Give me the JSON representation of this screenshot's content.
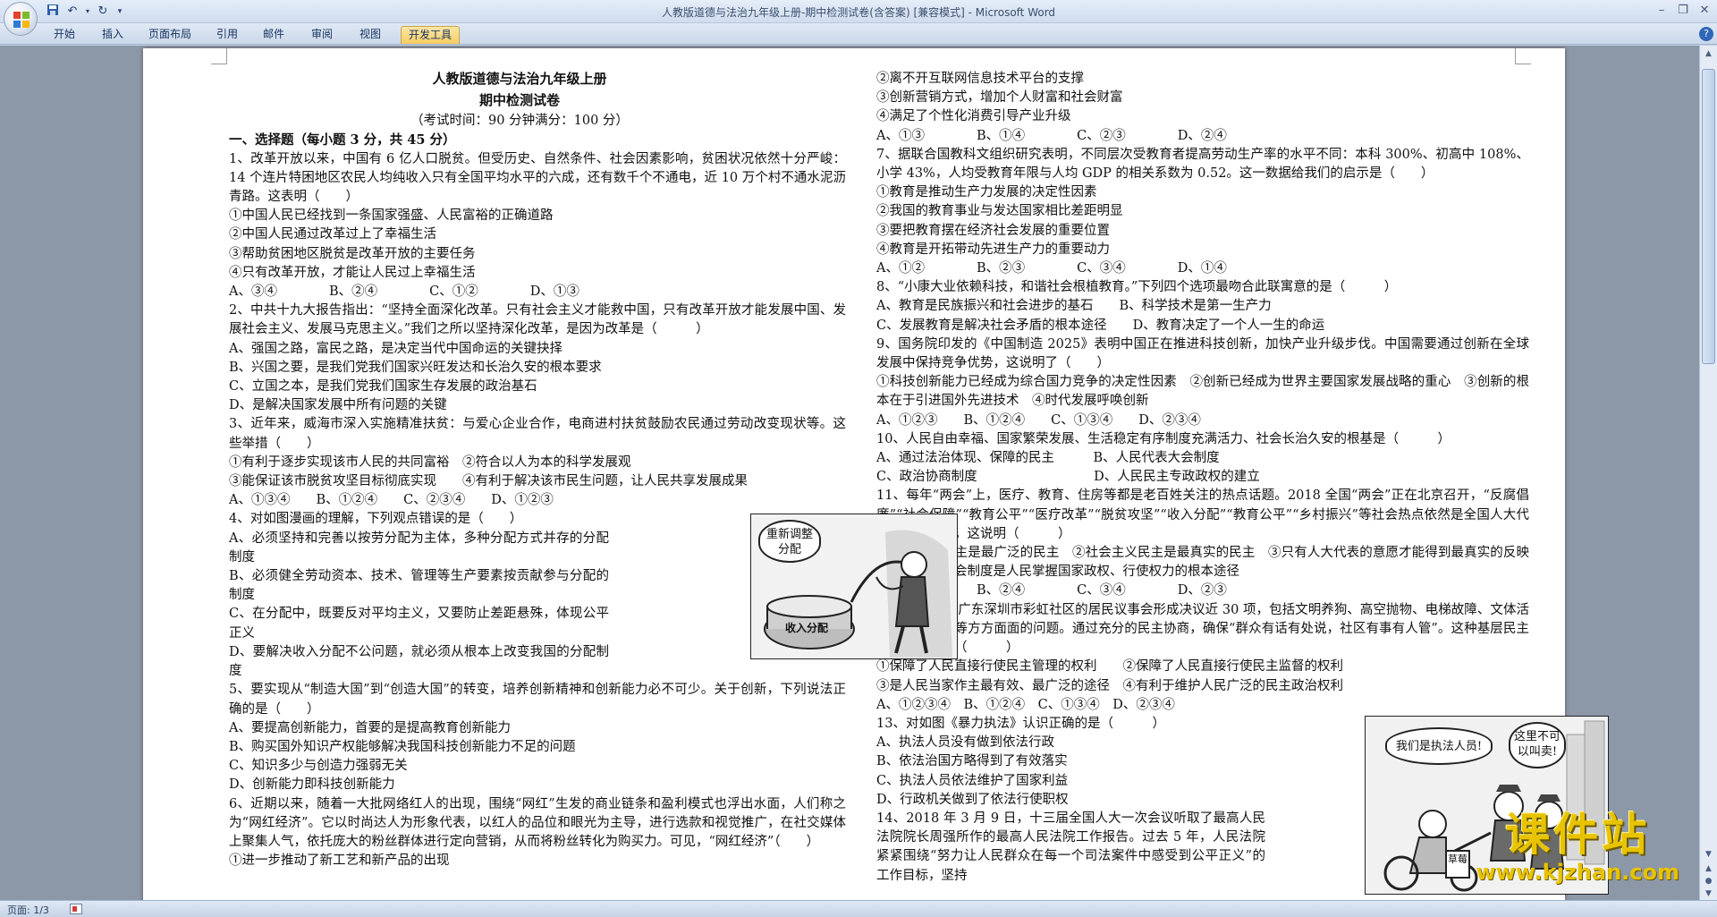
{
  "window": {
    "title": "人教版道德与法治九年级上册-期中检测试卷(含答案) [兼容模式] - Microsoft Word"
  },
  "ribbon": {
    "tabs": [
      "开始",
      "插入",
      "页面布局",
      "引用",
      "邮件",
      "审阅",
      "视图",
      "开发工具"
    ],
    "active_tab": "开发工具"
  },
  "document": {
    "title": "人教版道德与法治九年级上册",
    "subtitle": "期中检测试卷",
    "exam_info": "（考试时间：90 分钟满分：100 分）",
    "section1": "一、选择题（每小题 3 分，共 45 分）",
    "left_column": [
      "1、改革开放以来，中国有 6 亿人口脱贫。但受历史、自然条件、社会因素影响，贫困状况依然十分严峻：14 个连片特困地区农民人均纯收入只有全国平均水平的六成，还有数千个不通电，近 10 万个村不通水泥沥青路。这表明（　　）",
      "①中国人民已经找到一条国家强盛、人民富裕的正确道路",
      "②中国人民通过改革过上了幸福生活",
      "③帮助贫困地区脱贫是改革开放的主要任务",
      "④只有改革开放，才能让人民过上幸福生活",
      "A、③④　　　　B、②④　　　　C、①②　　　　D、①③",
      "2、中共十九大报告指出：“坚持全面深化改革。只有社会主义才能救中国，只有改革开放才能发展中国、发展社会主义、发展马克思主义。”我们之所以坚持深化改革，是因为改革是（　　　）",
      "A、强国之路，富民之路，是决定当代中国命运的关键抉择",
      "B、兴国之要，是我们党我们国家兴旺发达和长治久安的根本要求",
      "C、立国之本，是我们党我们国家生存发展的政治基石",
      "D、是解决国家发展中所有问题的关键",
      "3、近年来，威海市深入实施精准扶贫：与爱心企业合作，电商进村扶贫鼓励农民通过劳动改变现状等。这些举措（　　）",
      "①有利于逐步实现该市人民的共同富裕　②符合以人为本的科学发展观",
      "③能保证该市脱贫攻坚目标彻底实现　　④有利于解决该市民生问题，让人民共享发展成果",
      "A、①③④　　B、①②④　　C、②③④　　D、①②③",
      "4、对如图漫画的理解，下列观点错误的是（　　）",
      "A、必须坚持和完善以按劳分配为主体，多种分配方式并存的分配制度",
      "B、必须健全劳动资本、技术、管理等生产要素按贡献参与分配的制度",
      "C、在分配中，既要反对平均主义，又要防止差距悬殊，体现公平正义",
      "D、要解决收入分配不公问题，就必须从根本上改变我国的分配制度",
      "5、要实现从“制造大国”到“创造大国”的转变，培养创新精神和创新能力必不可少。关于创新，下列说法正确的是（　　）",
      "A、要提高创新能力，首要的是提高教育创新能力",
      "B、购买国外知识产权能够解决我国科技创新能力不足的问题",
      "C、知识多少与创造力强弱无关",
      "D、创新能力即科技创新能力",
      "6、近期以来，随着一大批网络红人的出现，围绕“网红”生发的商业链条和盈利模式也浮出水面，人们称之为“网红经济”。它以时尚达人为形象代表，以红人的品位和眼光为主导，进行选款和视觉推广，在社交媒体上聚集人气，依托庞大的粉丝群体进行定向营销，从而将粉丝转化为购买力。可见，“网红经济”（　　）",
      "①进一步推动了新工艺和新产品的出现"
    ],
    "right_column": [
      "②离不开互联网信息技术平台的支撑",
      "③创新营销方式，增加个人财富和社会财富",
      "④满足了个性化消费引导产业升级",
      "A、①③　　　　B、①④　　　　C、②③　　　　D、②④",
      "7、据联合国教科文组织研究表明，不同层次受教育者提高劳动生产率的水平不同：本科 300%、初高中 108%、小学 43%，人均受教育年限与人均 GDP 的相关系数为 0.52。这一数据给我们的启示是（　　）",
      "①教育是推动生产力发展的决定性因素",
      "②我国的教育事业与发达国家相比差距明显",
      "③要把教育摆在经济社会发展的重要位置",
      "④教育是开拓带动先进生产力的重要动力",
      "A、①②　　　　B、②③　　　　C、③④　　　　D、①④",
      "8、“小康大业依赖科技，和谐社会根植教育。”下列四个选项最吻合此联寓意的是（　　　）",
      "A、教育是民族振兴和社会进步的基石　　B、科学技术是第一生产力",
      "C、发展教育是解决社会矛盾的根本途径　　D、教育决定了一个人一生的命运",
      "9、国务院印发的《中国制造 2025》表明中国正在推进科技创新，加快产业升级步伐。中国需要通过创新在全球发展中保持竞争优势，这说明了（　　）",
      "①科技创新能力已经成为综合国力竞争的决定性因素　②创新已经成为世界主要国家发展战略的重心　③创新的根本在于引进国外先进技术　④时代发展呼唤创新",
      "A、①②③　　B、①②④　　C、①③④　　D、②③④",
      "10、人民自由幸福、国家繁荣发展、生活稳定有序制度充满活力、社会长治久安的根基是（　　　）",
      "A、通过法治体现、保障的民主　　　B、人民代表大会制度",
      "C、政治协商制度　　　　　　　　　D、人民民主专政政权的建立",
      "11、每年“两会”上，医疗、教育、住房等都是老百姓关注的热点话题。2018 全国“两会”正在北京召开，“反腐倡廉”“社会保障”“教育公平”“医疗改革”“脱贫攻坚”“收入分配”“教育公平”“乡村振兴”等社会热点依然是全国人大代表关注的问题。这说明（　　　）",
      "①社会主义民主是最广泛的民主　②社会主义民主是最真实的民主　③只有人大代表的意愿才能得到最真实的反映　④人民代表大会制度是人民掌握国家政权、行使权力的根本途径",
      "A、①②　　　　B、②④　　　　C、③④　　　　D、②③",
      "12、近年来，广东深圳市彩虹社区的居民议事会形成决议近 30 项，包括文明养狗、高空抛物、电梯故障、文体活动、儿童教育等方方面面的问题。通过充分的民主协商，确保“群众有话有处说，社区有事有人管”。这种基层民主的积极意义有（　　　）",
      "①保障了人民直接行使民主管理的权利　　②保障了人民直接行使民主监督的权利",
      "③是人民当家作主最有效、最广泛的途径　④有利于维护人民广泛的民主政治权利",
      "A、①②③④　B、①②④　C、①③④　D、②③④",
      "13、对如图《暴力执法》认识正确的是（　　　）",
      "A、执法人员没有做到依法行政",
      "B、依法治国方略得到了有效落实",
      "C、执法人员依法维护了国家利益",
      "D、行政机关做到了依法行使职权",
      "14、2018 年 3 月 9 日，十三届全国人大一次会议听取了最高人民法院院长周强所作的最高人民法院工作报告。过去 5 年，人民法院紧紧围绕“努力让人民群众在每一个司法案件中感受到公平正义”的工作目标，坚持"
    ]
  },
  "cartoon1": {
    "bubble": "重新调整分配",
    "label": "收入分配"
  },
  "cartoon2": {
    "bubble_left": "我们是执法人员!",
    "bubble_right": "这里不可以叫卖!",
    "sign": "草莓"
  },
  "watermark": {
    "title": "课件站",
    "url": "www.kjzhan.com"
  },
  "status": {
    "page": "页面: 1/3"
  },
  "colors": {
    "accent_tab": "#f6cd62",
    "watermark": "#e8c300"
  }
}
